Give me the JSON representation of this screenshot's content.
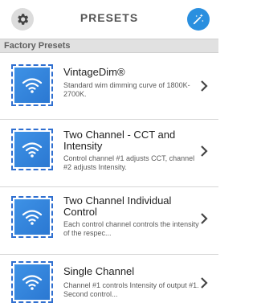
{
  "header": {
    "title": "PRESETS",
    "left_icon": "gear-icon",
    "right_icon": "magic-wand-icon"
  },
  "section": {
    "label": "Factory Presets"
  },
  "presets": [
    {
      "title": "VintageDim®",
      "description": "Standard wim dimming curve of 1800K-2700K.",
      "icon": "wifi-icon"
    },
    {
      "title": "Two Channel - CCT and Intensity",
      "description": "Control channel #1 adjusts CCT, channel #2 adjusts Intensity.",
      "icon": "wifi-icon"
    },
    {
      "title": "Two Channel Individual Control",
      "description": "Each control channel controls the intensity of the respec...",
      "icon": "wifi-icon"
    },
    {
      "title": "Single Channel",
      "description": "Channel #1 controls Intensity of output #1. Second control...",
      "icon": "wifi-icon"
    }
  ],
  "colors": {
    "accent": "#2a8fdf",
    "thumb_border": "#2f6fd0"
  }
}
